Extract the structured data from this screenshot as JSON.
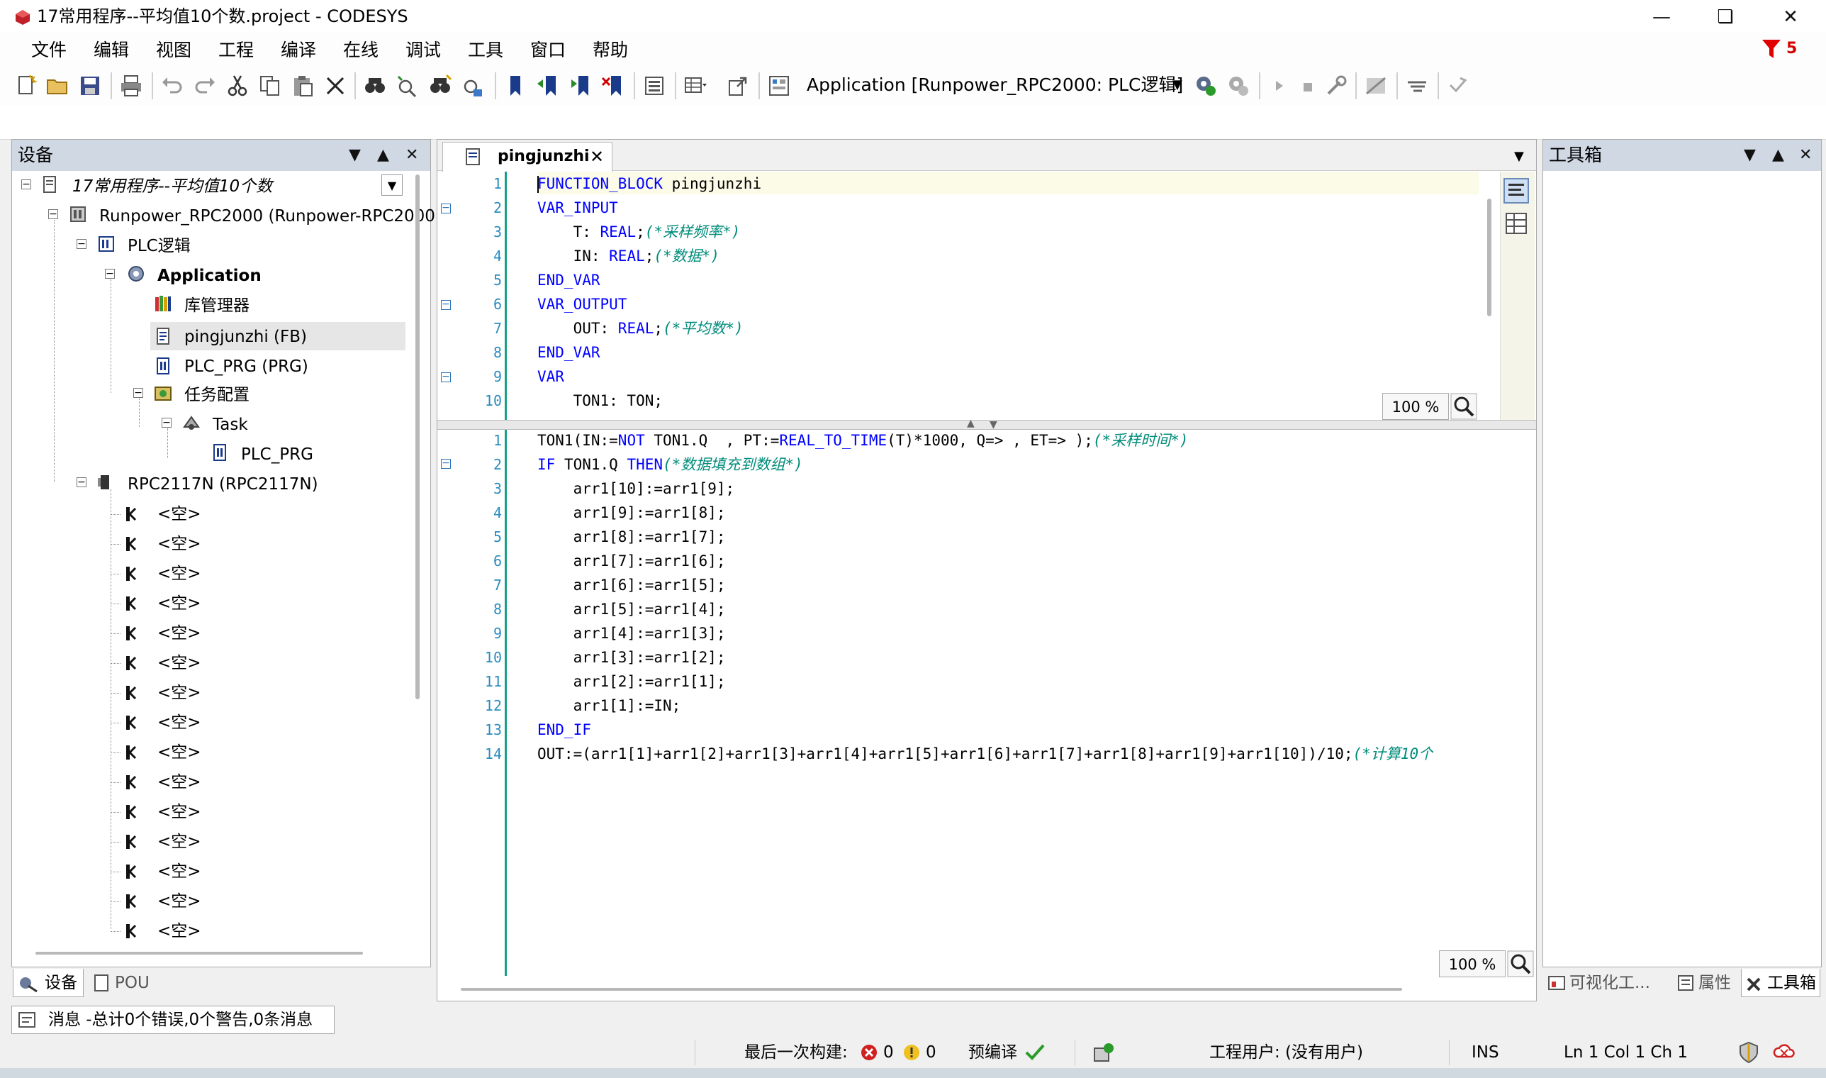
{
  "window": {
    "title": "17常用程序--平均值10个数.project - CODESYS"
  },
  "menu": [
    "文件",
    "编辑",
    "视图",
    "工程",
    "编译",
    "在线",
    "调试",
    "工具",
    "窗口",
    "帮助"
  ],
  "alert_count": "5",
  "toolbar": {
    "application_combo": "Application [Runpower_RPC2000: PLC逻辑]"
  },
  "devices_panel": {
    "title": "设备",
    "tree": [
      "17常用程序--平均值10个数",
      "Runpower_RPC2000 (Runpower-RPC2000)",
      "PLC逻辑",
      "Application",
      "库管理器",
      "pingjunzhi (FB)",
      "PLC_PRG (PRG)",
      "任务配置",
      "Task",
      "PLC_PRG",
      "RPC2117N (RPC2117N)"
    ],
    "empty_slot_label": "<空>",
    "tabs": [
      "设备",
      "POU"
    ]
  },
  "editor": {
    "tab_title": "pingjunzhi",
    "decl_zoom": "100 %",
    "impl_zoom": "100 %",
    "decl_lines": [
      [
        "1",
        "FUNCTION_BLOCK pingjunzhi"
      ],
      [
        "2",
        "VAR_INPUT"
      ],
      [
        "3",
        "    T: REAL;(*采样频率*)"
      ],
      [
        "4",
        "    IN: REAL;(*数据*)"
      ],
      [
        "5",
        "END_VAR"
      ],
      [
        "6",
        "VAR_OUTPUT"
      ],
      [
        "7",
        "    OUT: REAL;(*平均数*)"
      ],
      [
        "8",
        "END_VAR"
      ],
      [
        "9",
        "VAR"
      ],
      [
        "10",
        "    TON1: TON;"
      ]
    ],
    "impl_lines": [
      [
        "1",
        "TON1(IN:=NOT TON1.Q  , PT:=REAL_TO_TIME(T)*1000, Q=> , ET=> );(*采样时间*)"
      ],
      [
        "2",
        "IF TON1.Q THEN(*数据填充到数组*)"
      ],
      [
        "3",
        "    arr1[10]:=arr1[9];"
      ],
      [
        "4",
        "    arr1[9]:=arr1[8];"
      ],
      [
        "5",
        "    arr1[8]:=arr1[7];"
      ],
      [
        "6",
        "    arr1[7]:=arr1[6];"
      ],
      [
        "7",
        "    arr1[6]:=arr1[5];"
      ],
      [
        "8",
        "    arr1[5]:=arr1[4];"
      ],
      [
        "9",
        "    arr1[4]:=arr1[3];"
      ],
      [
        "10",
        "    arr1[3]:=arr1[2];"
      ],
      [
        "11",
        "    arr1[2]:=arr1[1];"
      ],
      [
        "12",
        "    arr1[1]:=IN;"
      ],
      [
        "13",
        "END_IF"
      ],
      [
        "14",
        "OUT:=(arr1[1]+arr1[2]+arr1[3]+arr1[4]+arr1[5]+arr1[6]+arr1[7]+arr1[8]+arr1[9]+arr1[10])/10;(*计算10个"
      ]
    ]
  },
  "toolbox_panel": {
    "title": "工具箱",
    "tabs": [
      "可视化工...",
      "属性",
      "工具箱"
    ]
  },
  "messages_tab": "消息 -总计0个错误,0个警告,0条消息",
  "status": {
    "last_build": "最后一次构建:",
    "errors": "0",
    "warnings": "0",
    "precompile": "预编译",
    "project_user": "工程用户: (没有用户)",
    "mode": "INS",
    "position": "Ln 1  Col 1  Ch 1"
  }
}
